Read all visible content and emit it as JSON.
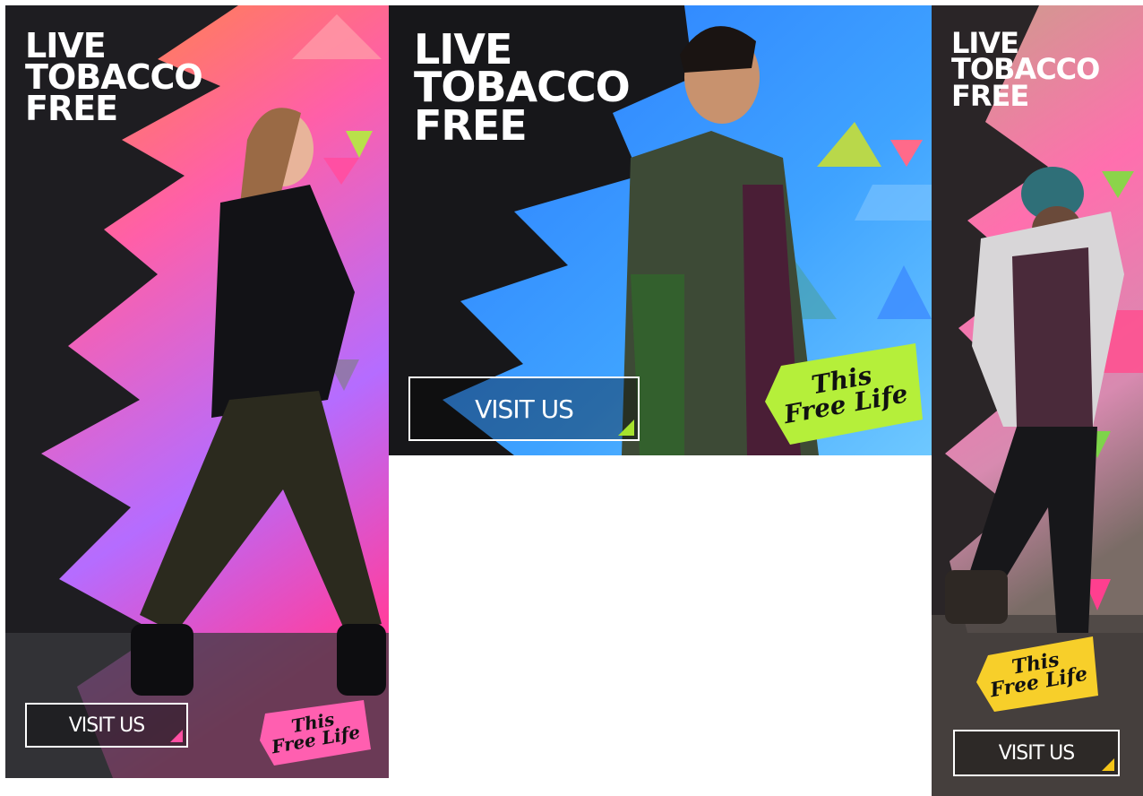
{
  "ads": [
    {
      "id": "left",
      "headline": [
        "LIVE",
        "TOBACCO",
        "FREE"
      ],
      "button_label": "VISIT US",
      "logo_text": [
        "This",
        "Free Life"
      ],
      "accent_color": "#ff4fa3",
      "logo_color": "#ff5fb0"
    },
    {
      "id": "middle",
      "headline": [
        "LIVE",
        "TOBACCO",
        "FREE"
      ],
      "button_label": "VISIT US",
      "logo_text": [
        "This",
        "Free Life"
      ],
      "accent_color": "#a6e22e",
      "logo_color": "#b5ef3a"
    },
    {
      "id": "right",
      "headline": [
        "LIVE",
        "TOBACCO",
        "FREE"
      ],
      "button_label": "VISIT US",
      "logo_text": [
        "This",
        "Free Life"
      ],
      "accent_color": "#f5c518",
      "logo_color": "#f7cf2a"
    }
  ]
}
